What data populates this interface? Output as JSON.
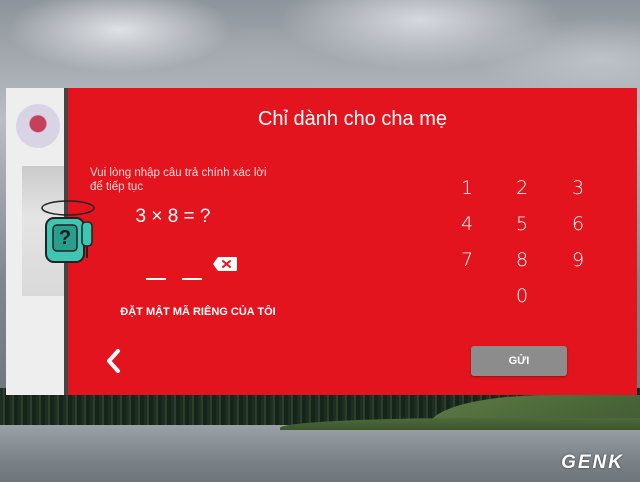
{
  "dialog": {
    "title": "Chỉ dành cho cha mẹ",
    "instructions": "Vui lòng nhập câu trả chính xác lời để tiếp tục",
    "question": "3 × 8 = ?",
    "custom_pin_link": "ĐẶT MẬT MÃ RIÊNG CỦA TÔI",
    "send_label": "GỬI",
    "keypad": [
      "1",
      "2",
      "3",
      "4",
      "5",
      "6",
      "7",
      "8",
      "9",
      "0"
    ],
    "accent_color": "#e4141e",
    "button_color": "#8c8c8c"
  },
  "watermark": "GENK",
  "icons": {
    "back": "chevron-left-icon",
    "backspace": "backspace-icon",
    "mascot": "lock-mascot-icon",
    "profile": "profile-avatar-icon"
  }
}
